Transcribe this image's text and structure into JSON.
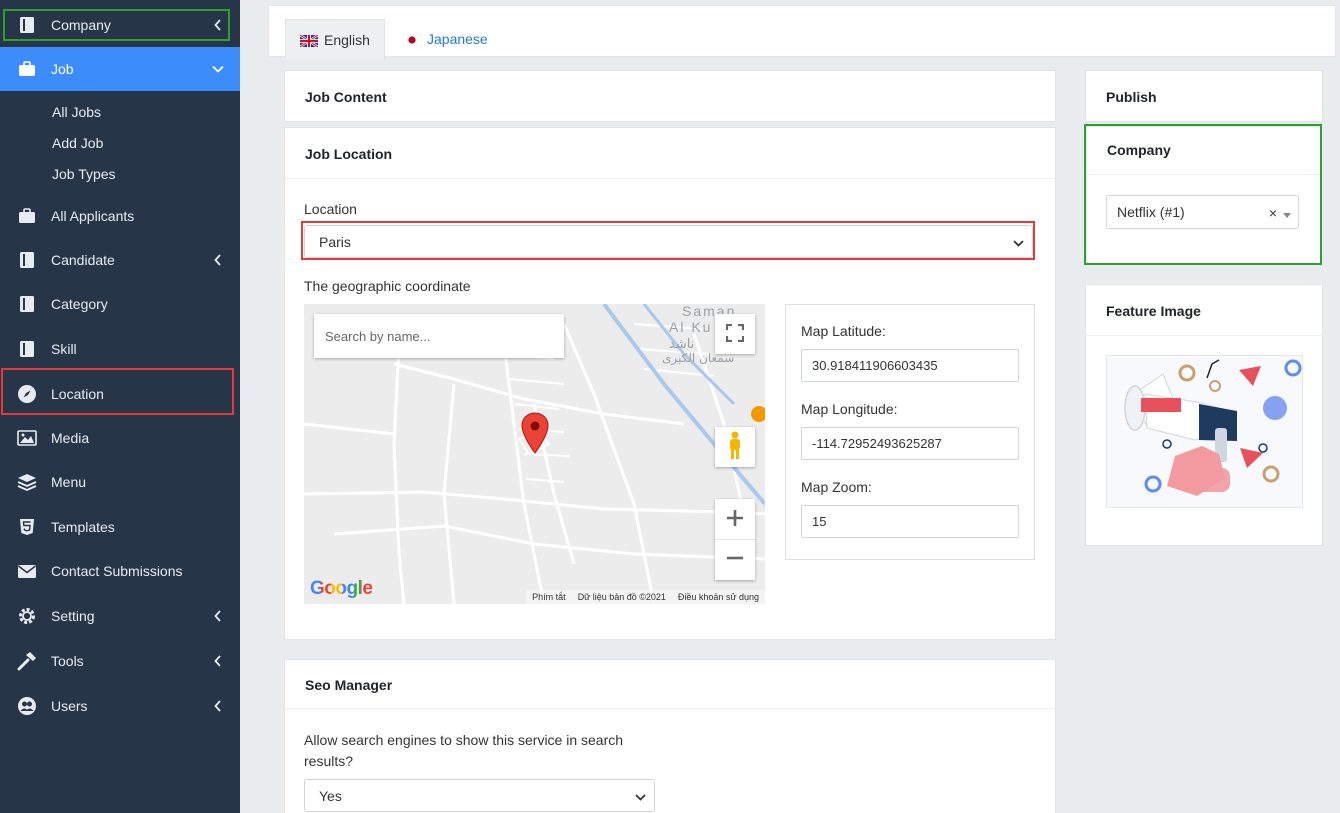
{
  "sidebar": {
    "company": "Company",
    "job": "Job",
    "job_sub": [
      "All Jobs",
      "Add Job",
      "Job Types"
    ],
    "all_applicants": "All Applicants",
    "candidate": "Candidate",
    "category": "Category",
    "skill": "Skill",
    "location": "Location",
    "media": "Media",
    "menu": "Menu",
    "templates": "Templates",
    "contact_submissions": "Contact Submissions",
    "setting": "Setting",
    "tools": "Tools",
    "users": "Users"
  },
  "tabs": {
    "english": "English",
    "japanese": "Japanese"
  },
  "job_content": {
    "title": "Job Content"
  },
  "job_location": {
    "title": "Job Location",
    "location_label": "Location",
    "location_value": "Paris",
    "geo_label": "The geographic coordinate",
    "map": {
      "search_placeholder": "Search by name...",
      "footer_shortcuts": "Phím tắt",
      "footer_data": "Dữ liệu bản đồ ©2021",
      "footer_terms": "Điều khoản sử dụng",
      "google": "Google",
      "place_label_1": "Saman",
      "place_label_2": "Al Ku",
      "place_label_3": "ناشد",
      "place_label_4": "سمعان الكبرى"
    },
    "latitude_label": "Map Latitude:",
    "latitude_value": "30.918411906603435",
    "longitude_label": "Map Longitude:",
    "longitude_value": "-114.72952493625287",
    "zoom_label": "Map Zoom:",
    "zoom_value": "15"
  },
  "seo": {
    "title": "Seo Manager",
    "allow_label_line1": "Allow search engines to show this service in search",
    "allow_label_line2": "results?",
    "allow_value": "Yes"
  },
  "publish": {
    "title": "Publish"
  },
  "company_box": {
    "title": "Company",
    "value": "Netflix (#1)",
    "clear": "×"
  },
  "feature_image": {
    "title": "Feature Image"
  },
  "colors": {
    "sidebar": "#273548",
    "active": "#3c8dfb",
    "highlight_red": "#e33b3b",
    "highlight_green": "#2ea02e"
  }
}
